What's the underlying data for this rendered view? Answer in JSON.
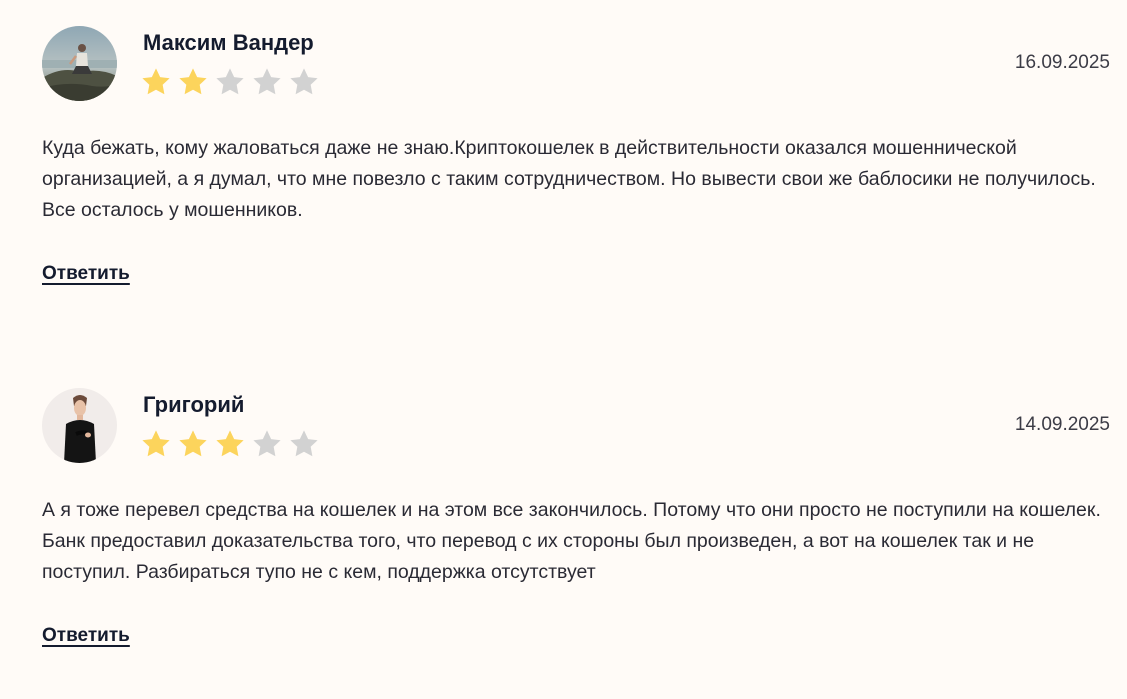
{
  "reviews": [
    {
      "author": "Максим Вандер",
      "date": "16.09.2025",
      "rating": 2,
      "max_rating": 5,
      "text": "Куда бежать, кому жаловаться даже не знаю.Криптокошелек в действительности оказался мошеннической организацией, а я думал, что мне повезло с таким сотрудничеством. Но вывести свои же баблосики не получилось. Все осталось у мошенников.",
      "reply_label": "Ответить"
    },
    {
      "author": "Григорий",
      "date": "14.09.2025",
      "rating": 3,
      "max_rating": 5,
      "text": "А я тоже перевел средства на кошелек и на этом все закончилось. Потому что они просто не поступили на кошелек. Банк предоставил доказательства того, что перевод с их стороны был произведен, а вот на кошелек так и не поступил. Разбираться тупо не с кем, поддержка отсутствует",
      "reply_label": "Ответить"
    }
  ],
  "colors": {
    "star_filled": "#fcd45c",
    "star_empty": "#d2d2d2",
    "background": "#fffbf7"
  },
  "icons": {
    "star": "star-icon",
    "avatar_1": "avatar-photo-seaside",
    "avatar_2": "avatar-photo-man-in-black"
  }
}
